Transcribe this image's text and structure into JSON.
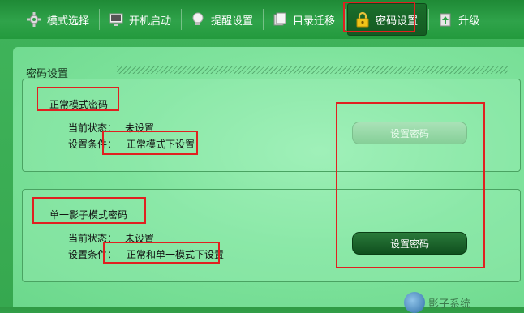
{
  "toolbar": {
    "items": [
      {
        "label": "模式选择",
        "icon": "gear-icon"
      },
      {
        "label": "开机启动",
        "icon": "monitor-icon"
      },
      {
        "label": "提醒设置",
        "icon": "bulb-icon"
      },
      {
        "label": "目录迁移",
        "icon": "folder-icon"
      },
      {
        "label": "密码设置",
        "icon": "lock-icon"
      },
      {
        "label": "升级",
        "icon": "upgrade-icon"
      }
    ]
  },
  "panel": {
    "title": "密码设置",
    "normal": {
      "title": "正常模式密码",
      "status_label": "当前状态：",
      "status_value": "未设置",
      "condition_label": "设置条件：",
      "condition_value": "正常模式下设置",
      "button": "设置密码"
    },
    "single": {
      "title": "单一影子模式密码",
      "status_label": "当前状态：",
      "status_value": "未设置",
      "condition_label": "设置条件：",
      "condition_value": "正常和单一模式下设置",
      "button": "设置密码"
    }
  },
  "logo_text": "影子系统",
  "colors": {
    "annotation": "#e02020",
    "toolbar": "#2fa34a",
    "panel": "#7fe39d",
    "button_active": "#145a22"
  }
}
